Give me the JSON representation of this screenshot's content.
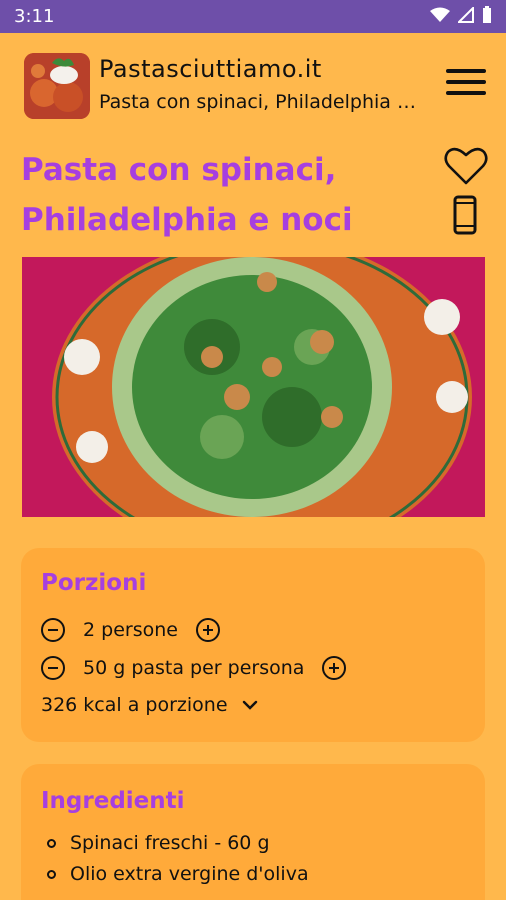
{
  "status_bar": {
    "time": "3:11"
  },
  "app_bar": {
    "title": "Pastasciuttiamo.it",
    "subtitle": "Pasta con spinaci, Philadelphia e noci"
  },
  "recipe": {
    "title": "Pasta con spinaci, Philadelphia e noci"
  },
  "porzioni": {
    "heading": "Porzioni",
    "people": "2 persone",
    "pasta": "50 g pasta per persona",
    "kcal": "326 kcal a porzione"
  },
  "ingredienti": {
    "heading": "Ingredienti",
    "items": [
      "Spinaci freschi - 60 g",
      "Olio extra vergine d'oliva"
    ]
  },
  "colors": {
    "accent": "#A63FE0",
    "background": "#FFB84C",
    "card": "#FFAA3A",
    "status_bar": "#6E4FA9"
  }
}
